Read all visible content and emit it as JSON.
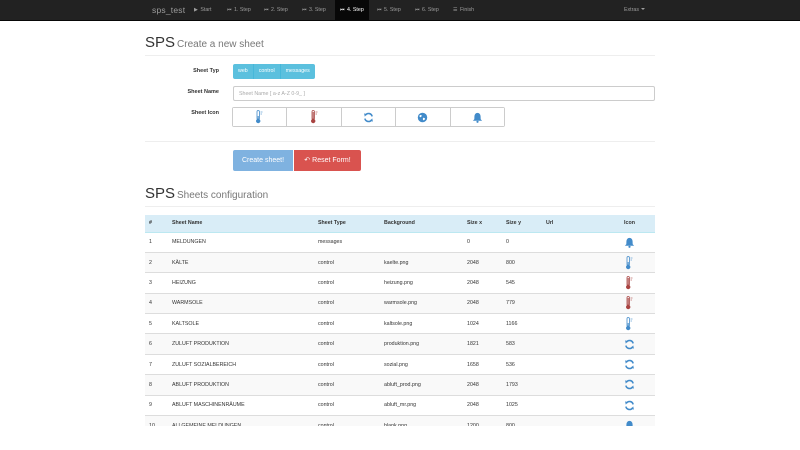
{
  "navbar": {
    "brand": "sps_test",
    "items": [
      {
        "icon": "play-icon",
        "glyph": "▶",
        "label": "Start",
        "active": false
      },
      {
        "icon": "step-icon",
        "glyph": "⏮",
        "label": "1. Step",
        "active": false
      },
      {
        "icon": "step-icon",
        "glyph": "⏮",
        "label": "2. Step",
        "active": false
      },
      {
        "icon": "step-icon",
        "glyph": "⏮",
        "label": "3. Step",
        "active": false
      },
      {
        "icon": "step-icon",
        "glyph": "⏮",
        "label": "4. Step",
        "active": true
      },
      {
        "icon": "step-icon",
        "glyph": "⏮",
        "label": "5. Step",
        "active": false
      },
      {
        "icon": "step-icon",
        "glyph": "⏮",
        "label": "6. Step",
        "active": false
      },
      {
        "icon": "list-icon",
        "glyph": "☰",
        "label": "Finish",
        "active": false
      }
    ],
    "extras": "Extras"
  },
  "create": {
    "title_big": "SPS",
    "title_small": "Create a new sheet",
    "type_label": "Sheet Typ",
    "types": [
      "web",
      "control",
      "messages"
    ],
    "name_label": "Sheet Name",
    "name_placeholder": "Sheet Name [ a-z A-Z 0-9_ ]",
    "name_value": "",
    "icon_label": "Sheet Icon",
    "icons": [
      "thermometer-cold-icon",
      "thermometer-hot-icon",
      "refresh-icon",
      "globe-icon",
      "bell-icon"
    ],
    "create_label": "Create sheet!",
    "reset_label": "Reset Form!"
  },
  "config": {
    "title_big": "SPS",
    "title_small": "Sheets configuration",
    "columns": [
      "#",
      "Sheet Name",
      "Sheet Type",
      "Background",
      "Size x",
      "Size y",
      "Url",
      "Icon"
    ],
    "rows": [
      {
        "num": "1",
        "name": "MELDUNGEN",
        "type": "messages",
        "background": "",
        "size_x": "0",
        "size_y": "0",
        "url": "",
        "icon": "bell-icon"
      },
      {
        "num": "2",
        "name": "KÄLTE",
        "type": "control",
        "background": "kaelte.png",
        "size_x": "2048",
        "size_y": "800",
        "url": "",
        "icon": "thermometer-cold-icon"
      },
      {
        "num": "3",
        "name": "HEIZUNG",
        "type": "control",
        "background": "heizung.png",
        "size_x": "2048",
        "size_y": "545",
        "url": "",
        "icon": "thermometer-hot-icon"
      },
      {
        "num": "4",
        "name": "WARMSOLE",
        "type": "control",
        "background": "warmsole.png",
        "size_x": "2048",
        "size_y": "779",
        "url": "",
        "icon": "thermometer-hot-icon"
      },
      {
        "num": "5",
        "name": "KALTSOLE",
        "type": "control",
        "background": "kaltsole.png",
        "size_x": "1024",
        "size_y": "1166",
        "url": "",
        "icon": "thermometer-cold-icon"
      },
      {
        "num": "6",
        "name": "ZULUFT PRODUKTION",
        "type": "control",
        "background": "produktion.png",
        "size_x": "1821",
        "size_y": "583",
        "url": "",
        "icon": "refresh-icon"
      },
      {
        "num": "7",
        "name": "ZULUFT SOZIALBEREICH",
        "type": "control",
        "background": "sozial.png",
        "size_x": "1658",
        "size_y": "536",
        "url": "",
        "icon": "refresh-icon"
      },
      {
        "num": "8",
        "name": "ABLUFT PRODUKTION",
        "type": "control",
        "background": "abluft_prod.png",
        "size_x": "2048",
        "size_y": "1793",
        "url": "",
        "icon": "refresh-icon"
      },
      {
        "num": "9",
        "name": "ABLUFT MASCHINENRÄUME",
        "type": "control",
        "background": "abluft_mr.png",
        "size_x": "2048",
        "size_y": "1025",
        "url": "",
        "icon": "refresh-icon"
      },
      {
        "num": "10",
        "name": "ALLGEMEINE MELDUNGEN",
        "type": "control",
        "background": "blank.png",
        "size_x": "1200",
        "size_y": "800",
        "url": "",
        "icon": "bell-icon"
      }
    ]
  },
  "colors": {
    "navbar_bg": "#222222",
    "navbar_active": "#080808",
    "info": "#5bc0de",
    "primary_light": "#7fb2e0",
    "danger": "#d9534f",
    "table_header": "#d9edf7",
    "icon_blue": "#428bca",
    "icon_red": "#a94442"
  }
}
